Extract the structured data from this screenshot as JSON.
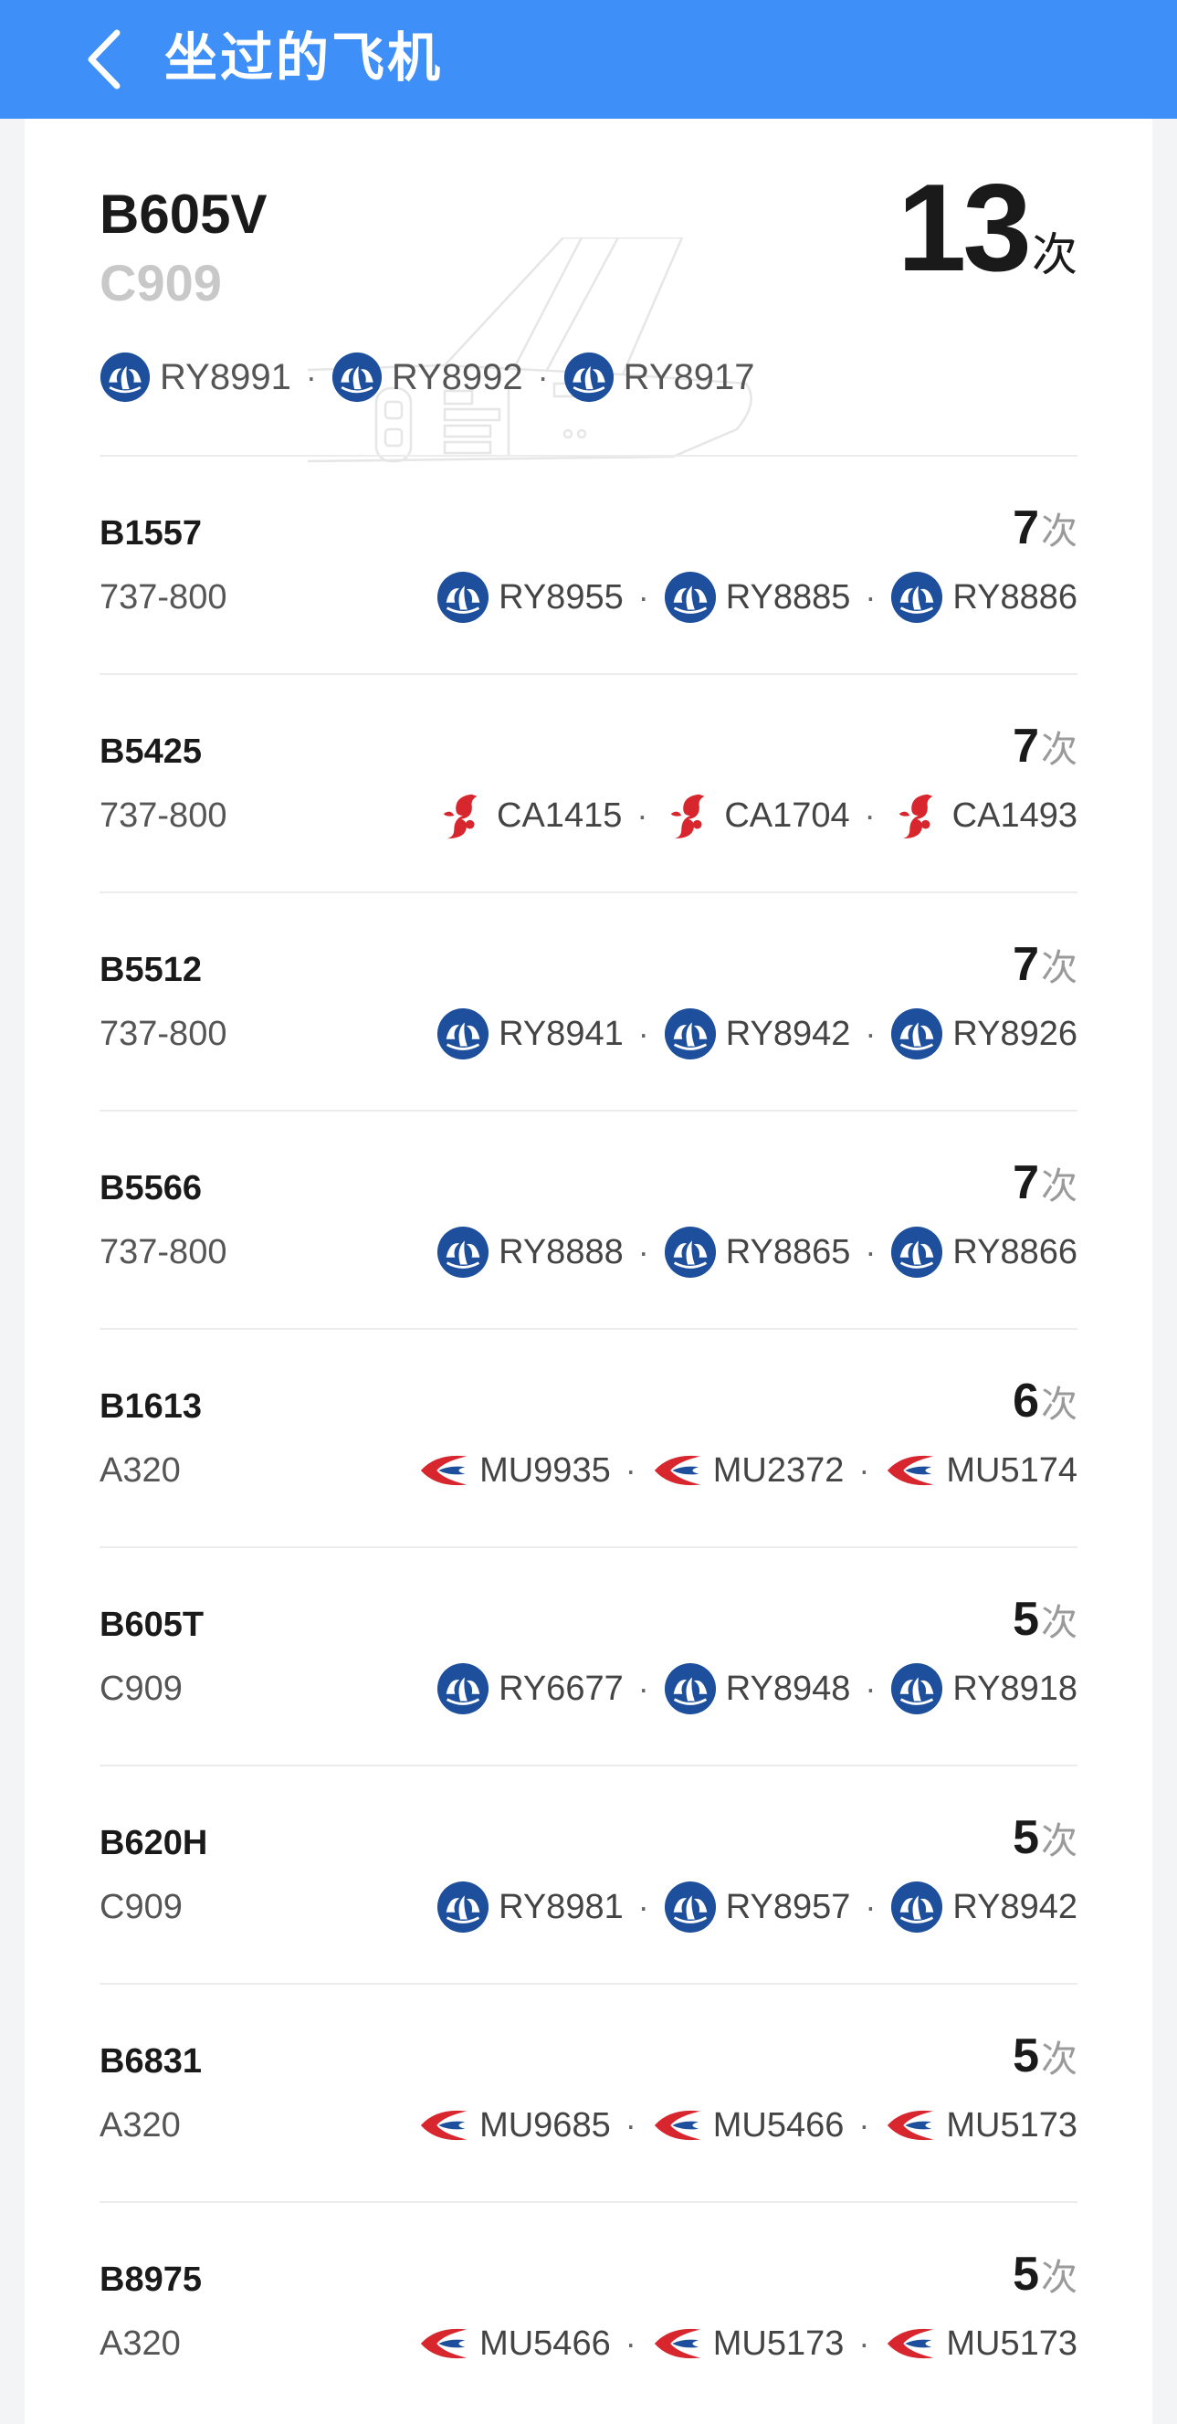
{
  "header": {
    "title": "坐过的飞机"
  },
  "featured": {
    "registration": "B605V",
    "aircraft_type": "C909",
    "count": "13",
    "unit": "次",
    "flights": [
      {
        "code": "RY8991",
        "airline_icon": "chengdu-airlines-logo"
      },
      {
        "code": "RY8992",
        "airline_icon": "chengdu-airlines-logo"
      },
      {
        "code": "RY8917",
        "airline_icon": "chengdu-airlines-logo"
      }
    ]
  },
  "separator": "·",
  "planes": [
    {
      "registration": "B1557",
      "aircraft_type": "737-800",
      "count": "7",
      "unit": "次",
      "flights": [
        {
          "code": "RY8955",
          "airline_icon": "chengdu-airlines-logo"
        },
        {
          "code": "RY8885",
          "airline_icon": "chengdu-airlines-logo"
        },
        {
          "code": "RY8886",
          "airline_icon": "chengdu-airlines-logo"
        }
      ]
    },
    {
      "registration": "B5425",
      "aircraft_type": "737-800",
      "count": "7",
      "unit": "次",
      "flights": [
        {
          "code": "CA1415",
          "airline_icon": "air-china-logo"
        },
        {
          "code": "CA1704",
          "airline_icon": "air-china-logo"
        },
        {
          "code": "CA1493",
          "airline_icon": "air-china-logo"
        }
      ]
    },
    {
      "registration": "B5512",
      "aircraft_type": "737-800",
      "count": "7",
      "unit": "次",
      "flights": [
        {
          "code": "RY8941",
          "airline_icon": "chengdu-airlines-logo"
        },
        {
          "code": "RY8942",
          "airline_icon": "chengdu-airlines-logo"
        },
        {
          "code": "RY8926",
          "airline_icon": "chengdu-airlines-logo"
        }
      ]
    },
    {
      "registration": "B5566",
      "aircraft_type": "737-800",
      "count": "7",
      "unit": "次",
      "flights": [
        {
          "code": "RY8888",
          "airline_icon": "chengdu-airlines-logo"
        },
        {
          "code": "RY8865",
          "airline_icon": "chengdu-airlines-logo"
        },
        {
          "code": "RY8866",
          "airline_icon": "chengdu-airlines-logo"
        }
      ]
    },
    {
      "registration": "B1613",
      "aircraft_type": "A320",
      "count": "6",
      "unit": "次",
      "flights": [
        {
          "code": "MU9935",
          "airline_icon": "china-eastern-logo"
        },
        {
          "code": "MU2372",
          "airline_icon": "china-eastern-logo"
        },
        {
          "code": "MU5174",
          "airline_icon": "china-eastern-logo"
        }
      ]
    },
    {
      "registration": "B605T",
      "aircraft_type": "C909",
      "count": "5",
      "unit": "次",
      "flights": [
        {
          "code": "RY6677",
          "airline_icon": "chengdu-airlines-logo"
        },
        {
          "code": "RY8948",
          "airline_icon": "chengdu-airlines-logo"
        },
        {
          "code": "RY8918",
          "airline_icon": "chengdu-airlines-logo"
        }
      ]
    },
    {
      "registration": "B620H",
      "aircraft_type": "C909",
      "count": "5",
      "unit": "次",
      "flights": [
        {
          "code": "RY8981",
          "airline_icon": "chengdu-airlines-logo"
        },
        {
          "code": "RY8957",
          "airline_icon": "chengdu-airlines-logo"
        },
        {
          "code": "RY8942",
          "airline_icon": "chengdu-airlines-logo"
        }
      ]
    },
    {
      "registration": "B6831",
      "aircraft_type": "A320",
      "count": "5",
      "unit": "次",
      "flights": [
        {
          "code": "MU9685",
          "airline_icon": "china-eastern-logo"
        },
        {
          "code": "MU5466",
          "airline_icon": "china-eastern-logo"
        },
        {
          "code": "MU5173",
          "airline_icon": "china-eastern-logo"
        }
      ]
    },
    {
      "registration": "B8975",
      "aircraft_type": "A320",
      "count": "5",
      "unit": "次",
      "flights": [
        {
          "code": "MU5466",
          "airline_icon": "china-eastern-logo"
        },
        {
          "code": "MU5173",
          "airline_icon": "china-eastern-logo"
        },
        {
          "code": "MU5173",
          "airline_icon": "china-eastern-logo"
        }
      ]
    }
  ]
}
